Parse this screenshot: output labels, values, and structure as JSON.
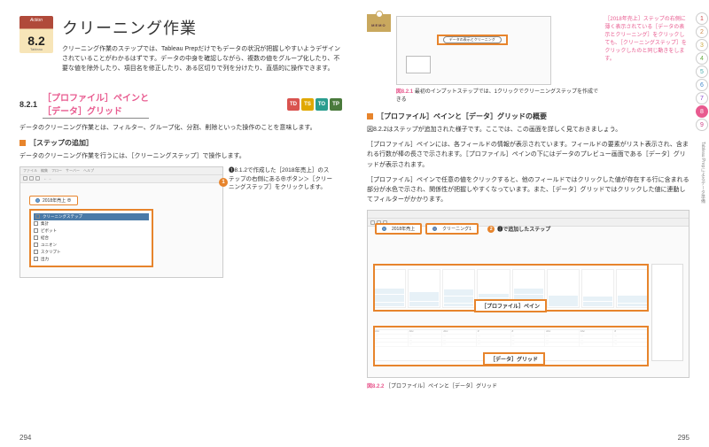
{
  "section": {
    "icon_top": "Action",
    "icon_num": "8.2",
    "icon_bot": "Tableau",
    "title": "クリーニング作業",
    "lead": "クリーニング作業のステップでは、Tableau Prepだけでもデータの状況が把握しやすいようデザインされていることがわかるはずです。データの中身を確認しながら、複数の値をグループ化したり、不要な値を除外したり、項目名を修正したり、ある区切りで列を分けたり、直感的に操作できます。"
  },
  "sub": {
    "num": "8.2.1",
    "title": "［プロファイル］ペインと\n［データ］グリッド",
    "badges": [
      "TD",
      "TS",
      "TO",
      "TP"
    ],
    "text": "データのクリーニング作業とは、フィルター、グループ化、分割、削除といった操作のことを意味します。"
  },
  "step_add": {
    "heading": "［ステップの追加］",
    "text": "データのクリーニング作業を行うには、［クリーニングステップ］で操作します。",
    "callout": "❶8.1.2で作成した［2018年売上］のステップの右側にある⊕ボタン＞［クリーニングステップ］をクリックします。",
    "flow_label": "2018年売上",
    "menu": [
      "クリーニングステップ",
      "集計",
      "ピボット",
      "結合",
      "ユニオン",
      "スクリプト",
      "出力"
    ]
  },
  "memo": {
    "tag": "MEMO",
    "side_text": "［2018年売上］ステップの右側に薄く表示されている［データの表示とクリーニング］をクリックしても、［クリーニングステップ］をクリックしたのと同じ動きをします。",
    "fig_num": "図8.2.1",
    "fig_cap": "最初のインプットステップでは、1クリックでクリーニングステップを作成できる",
    "pill": "データの表示とクリーニング"
  },
  "overview": {
    "heading": "［プロファイル］ペインと［データ］グリッドの概要",
    "p1": "図8.2.2はステップが追加された様子です。ここでは、この画面を詳しく見ておきましょう。",
    "p2": "［プロファイル］ペインには、各フィールドの情報が表示されています。フィールドの要素がリスト表示され、含まれる行数が棒の長さで示されます。［プロファイル］ペインの下にはデータのプレビュー画面である［データ］グリッドが表示されます。",
    "p3": "［プロファイル］ペインで任意の値をクリックすると、他のフィールドではクリックした値が存在する行に含まれる部分が水色で示され、関係性が把握しやすくなっています。また、［データ］グリッドではクリックした値に連動してフィルターがかかります。",
    "added_step_label": "❷で追加したステップ",
    "pane1_label": "［プロファイル］ペイン",
    "pane2_label": "［データ］グリッド",
    "fig_num": "図8.2.2",
    "fig_cap": "［プロファイル］ペインと［データ］グリッド"
  },
  "flow_pills": [
    "2018年売上",
    "クリーニング1"
  ],
  "thumb_labels": [
    "1",
    "2",
    "3",
    "4",
    "5",
    "6",
    "7",
    "8",
    "9"
  ],
  "side_vert": "Tableau Prepによるデータ準備",
  "page_left": "294",
  "page_right": "295"
}
